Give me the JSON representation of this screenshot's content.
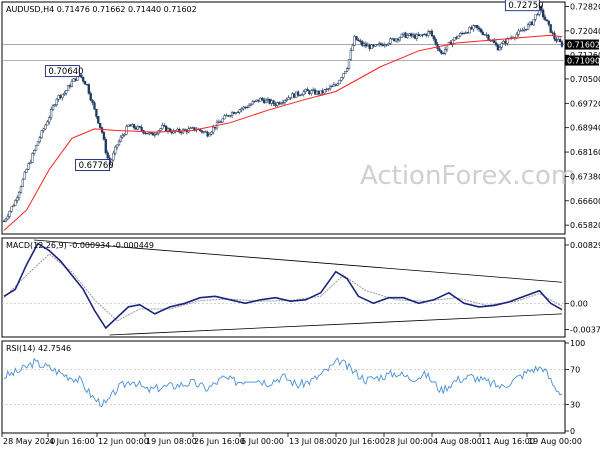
{
  "header": {
    "main_label": "AUDUSD,H4  0.71476 0.71662 0.71440 0.71602",
    "macd_label": "MACD(12,26,9) -0.000934 -0.000449",
    "rsi_label": "RSI(14) 42.7546"
  },
  "watermark": "ActionForex.com",
  "colors": {
    "candles": "#1f3a5f",
    "ma_line": "#ff2020",
    "macd_line": "#1a237e",
    "macd_signal": "#9a9a9a",
    "rsi_line": "#4a90d9",
    "trendline": "#000000"
  },
  "chart_data": [
    {
      "type": "candlestick",
      "symbol": "AUDUSD",
      "timeframe": "H4",
      "ohlc_current": {
        "open": 0.71476,
        "high": 0.71662,
        "low": 0.7144,
        "close": 0.71602
      },
      "ylim": [
        0.656,
        0.729
      ],
      "y_ticks": [
        "0.72820",
        "0.72040",
        "0.71260",
        "0.70500",
        "0.69720",
        "0.68940",
        "0.68160",
        "0.67380",
        "0.66600",
        "0.65820"
      ],
      "x_ticks": [
        "28 May 2020",
        "4 Jun 16:00",
        "12 Jun 00:00",
        "19 Jun 08:00",
        "26 Jun 16:00",
        "6 Jul 00:00",
        "13 Jul 08:00",
        "20 Jul 16:00",
        "28 Jul 00:00",
        "4 Aug 08:00",
        "11 Aug 16:00",
        "19 Aug 00:00"
      ],
      "price_boxes": [
        {
          "label": "0.71602",
          "value": 0.71602,
          "style": "filled"
        },
        {
          "label": "0.71090",
          "value": 0.7109,
          "style": "filled"
        }
      ],
      "horizontal_levels": [
        0.71602,
        0.7109
      ],
      "annotations": [
        {
          "label": "0.70640",
          "value": 0.7064
        },
        {
          "label": "0.67760",
          "value": 0.6776
        },
        {
          "label": "0.72750",
          "value": 0.7275
        }
      ],
      "price_path": [
        [
          0,
          0.6595
        ],
        [
          3,
          0.666
        ],
        [
          6,
          0.676
        ],
        [
          9,
          0.685
        ],
        [
          12,
          0.693
        ],
        [
          14,
          0.699
        ],
        [
          16,
          0.7005
        ],
        [
          18,
          0.704
        ],
        [
          20,
          0.7064
        ],
        [
          22,
          0.703
        ],
        [
          24,
          0.695
        ],
        [
          26,
          0.688
        ],
        [
          27,
          0.682
        ],
        [
          28,
          0.6776
        ],
        [
          30,
          0.684
        ],
        [
          33,
          0.69
        ],
        [
          36,
          0.689
        ],
        [
          39,
          0.687
        ],
        [
          42,
          0.6895
        ],
        [
          45,
          0.688
        ],
        [
          48,
          0.6885
        ],
        [
          51,
          0.689
        ],
        [
          54,
          0.6875
        ],
        [
          57,
          0.691
        ],
        [
          60,
          0.694
        ],
        [
          64,
          0.696
        ],
        [
          68,
          0.6985
        ],
        [
          72,
          0.697
        ],
        [
          76,
          0.6995
        ],
        [
          80,
          0.701
        ],
        [
          84,
          0.7005
        ],
        [
          88,
          0.703
        ],
        [
          91,
          0.709
        ],
        [
          93,
          0.718
        ],
        [
          95,
          0.716
        ],
        [
          98,
          0.715
        ],
        [
          102,
          0.717
        ],
        [
          106,
          0.719
        ],
        [
          110,
          0.7185
        ],
        [
          113,
          0.72
        ],
        [
          116,
          0.713
        ],
        [
          119,
          0.7175
        ],
        [
          122,
          0.72
        ],
        [
          125,
          0.7215
        ],
        [
          128,
          0.719
        ],
        [
          131,
          0.715
        ],
        [
          134,
          0.718
        ],
        [
          137,
          0.72
        ],
        [
          140,
          0.723
        ],
        [
          142,
          0.7275
        ],
        [
          144,
          0.723
        ],
        [
          146,
          0.718
        ],
        [
          148,
          0.716
        ]
      ],
      "ma_path": [
        [
          0,
          0.6565
        ],
        [
          6,
          0.663
        ],
        [
          12,
          0.676
        ],
        [
          18,
          0.686
        ],
        [
          24,
          0.689
        ],
        [
          30,
          0.6885
        ],
        [
          40,
          0.688
        ],
        [
          50,
          0.6885
        ],
        [
          60,
          0.691
        ],
        [
          70,
          0.695
        ],
        [
          80,
          0.6985
        ],
        [
          88,
          0.701
        ],
        [
          94,
          0.705
        ],
        [
          100,
          0.709
        ],
        [
          110,
          0.714
        ],
        [
          120,
          0.7165
        ],
        [
          130,
          0.7175
        ],
        [
          140,
          0.7185
        ],
        [
          145,
          0.719
        ],
        [
          148,
          0.7185
        ]
      ]
    },
    {
      "type": "line",
      "name": "MACD(12,26,9)",
      "ylim": [
        -0.0045,
        0.009
      ],
      "y_ticks": [
        "0.008296",
        "0.00",
        "-0.003725"
      ],
      "macd_path": [
        [
          0,
          0.001
        ],
        [
          3,
          0.002
        ],
        [
          6,
          0.0055
        ],
        [
          9,
          0.0085
        ],
        [
          12,
          0.0075
        ],
        [
          15,
          0.006
        ],
        [
          18,
          0.004
        ],
        [
          21,
          0.002
        ],
        [
          24,
          -0.001
        ],
        [
          27,
          -0.0035
        ],
        [
          30,
          -0.002
        ],
        [
          33,
          -0.0005
        ],
        [
          36,
          -0.0002
        ],
        [
          40,
          -0.0015
        ],
        [
          44,
          -0.0005
        ],
        [
          48,
          0.0
        ],
        [
          52,
          0.0008
        ],
        [
          56,
          0.001
        ],
        [
          60,
          0.0005
        ],
        [
          64,
          0.0
        ],
        [
          68,
          0.0005
        ],
        [
          72,
          0.0008
        ],
        [
          76,
          0.0003
        ],
        [
          80,
          0.0005
        ],
        [
          84,
          0.0015
        ],
        [
          88,
          0.0045
        ],
        [
          91,
          0.0035
        ],
        [
          94,
          0.001
        ],
        [
          98,
          0.0
        ],
        [
          102,
          0.0008
        ],
        [
          106,
          0.0008
        ],
        [
          110,
          0.0
        ],
        [
          114,
          0.0005
        ],
        [
          118,
          0.0015
        ],
        [
          122,
          0.0
        ],
        [
          126,
          -0.0005
        ],
        [
          130,
          -0.0003
        ],
        [
          134,
          0.0002
        ],
        [
          138,
          0.001
        ],
        [
          142,
          0.0018
        ],
        [
          145,
          0.0
        ],
        [
          148,
          -0.0009
        ]
      ],
      "signal_path": [
        [
          0,
          0.0008
        ],
        [
          6,
          0.004
        ],
        [
          12,
          0.007
        ],
        [
          18,
          0.0045
        ],
        [
          24,
          0.0005
        ],
        [
          30,
          -0.0025
        ],
        [
          36,
          -0.0008
        ],
        [
          44,
          -0.0008
        ],
        [
          52,
          0.0004
        ],
        [
          60,
          0.0006
        ],
        [
          68,
          0.0003
        ],
        [
          76,
          0.0004
        ],
        [
          84,
          0.001
        ],
        [
          90,
          0.004
        ],
        [
          96,
          0.0018
        ],
        [
          104,
          0.0005
        ],
        [
          112,
          0.0003
        ],
        [
          120,
          0.0008
        ],
        [
          128,
          -0.0003
        ],
        [
          136,
          0.0003
        ],
        [
          142,
          0.0014
        ],
        [
          148,
          -0.0004
        ]
      ],
      "trendlines": [
        {
          "from": [
            8,
            0.009
          ],
          "to": [
            148,
            0.003
          ]
        },
        {
          "from": [
            28,
            -0.0045
          ],
          "to": [
            148,
            -0.0015
          ]
        }
      ]
    },
    {
      "type": "line",
      "name": "RSI(14)",
      "ylim": [
        0,
        100
      ],
      "y_ticks": [
        "100",
        "70",
        "30",
        "0"
      ],
      "levels": [
        70,
        30
      ],
      "rsi_path": [
        [
          0,
          62
        ],
        [
          4,
          68
        ],
        [
          8,
          78
        ],
        [
          12,
          72
        ],
        [
          16,
          64
        ],
        [
          20,
          58
        ],
        [
          24,
          36
        ],
        [
          27,
          30
        ],
        [
          30,
          48
        ],
        [
          34,
          58
        ],
        [
          38,
          46
        ],
        [
          42,
          50
        ],
        [
          46,
          52
        ],
        [
          50,
          55
        ],
        [
          54,
          48
        ],
        [
          58,
          60
        ],
        [
          62,
          56
        ],
        [
          66,
          60
        ],
        [
          70,
          55
        ],
        [
          74,
          62
        ],
        [
          78,
          52
        ],
        [
          82,
          58
        ],
        [
          86,
          70
        ],
        [
          89,
          80
        ],
        [
          92,
          70
        ],
        [
          96,
          58
        ],
        [
          100,
          62
        ],
        [
          104,
          66
        ],
        [
          108,
          60
        ],
        [
          112,
          64
        ],
        [
          116,
          46
        ],
        [
          120,
          58
        ],
        [
          124,
          62
        ],
        [
          128,
          56
        ],
        [
          132,
          50
        ],
        [
          136,
          60
        ],
        [
          140,
          70
        ],
        [
          143,
          72
        ],
        [
          146,
          50
        ],
        [
          148,
          43
        ]
      ]
    }
  ]
}
